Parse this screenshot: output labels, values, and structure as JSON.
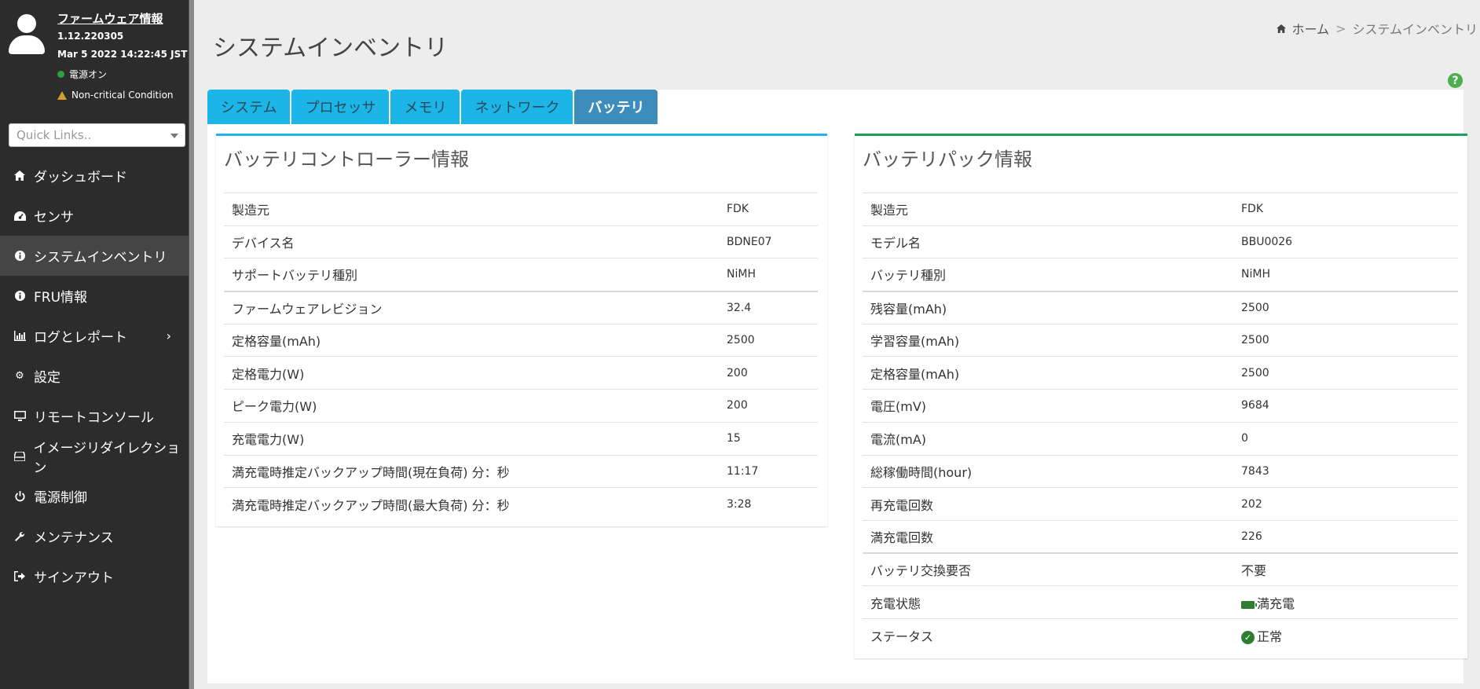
{
  "sidebar": {
    "fw_title": "ファームウェア情報",
    "fw_version": "1.12.220305",
    "fw_date": "Mar 5 2022 14:22:45 JST",
    "power_status": "電源オン",
    "health_status": "Non-critical Condition",
    "quicklinks_placeholder": "Quick Links..",
    "menu": [
      {
        "label": "ダッシュボード",
        "icon": "home-icon"
      },
      {
        "label": "センサ",
        "icon": "gauge-icon"
      },
      {
        "label": "システムインベントリ",
        "icon": "info-icon",
        "active": true
      },
      {
        "label": "FRU情報",
        "icon": "info-icon"
      },
      {
        "label": "ログとレポート",
        "icon": "bar-chart-icon"
      },
      {
        "label": "設定",
        "icon": "gear-icon"
      },
      {
        "label": "リモートコンソール",
        "icon": "monitor-icon"
      },
      {
        "label": "イメージリダイレクション",
        "icon": "drive-icon"
      },
      {
        "label": "電源制御",
        "icon": "power-icon"
      },
      {
        "label": "メンテナンス",
        "icon": "wrench-icon"
      },
      {
        "label": "サインアウト",
        "icon": "sign-out-icon"
      }
    ]
  },
  "header": {
    "title": "システムインベントリ",
    "breadcrumb_home": "ホーム",
    "breadcrumb_sep": ">",
    "breadcrumb_current": "システムインベントリ",
    "help_symbol": "?"
  },
  "tabs": [
    "システム",
    "プロセッサ",
    "メモリ",
    "ネットワーク",
    "バッテリ"
  ],
  "active_tab": "バッテリ",
  "controller": {
    "title": "バッテリコントローラー情報",
    "rows": [
      {
        "key": "製造元",
        "value": "FDK"
      },
      {
        "key": "デバイス名",
        "value": "BDNE07"
      },
      {
        "key": "サポートバッテリ種別",
        "value": "NiMH"
      },
      {
        "key": "ファームウェアレビジョン",
        "value": "32.4"
      },
      {
        "key": "定格容量(mAh)",
        "value": "2500"
      },
      {
        "key": "定格電力(W)",
        "value": "200"
      },
      {
        "key": "ピーク電力(W)",
        "value": "200"
      },
      {
        "key": "充電電力(W)",
        "value": "15"
      },
      {
        "key": "満充電時推定バックアップ時間(現在負荷) 分：秒",
        "value": "11:17"
      },
      {
        "key": "満充電時推定バックアップ時間(最大負荷) 分：秒",
        "value": "3:28"
      }
    ]
  },
  "pack": {
    "title": "バッテリパック情報",
    "rows": [
      {
        "key": "製造元",
        "value": "FDK"
      },
      {
        "key": "モデル名",
        "value": "BBU0026"
      },
      {
        "key": "バッテリ種別",
        "value": "NiMH"
      },
      {
        "key": "残容量(mAh)",
        "value": "2500"
      },
      {
        "key": "学習容量(mAh)",
        "value": "2500"
      },
      {
        "key": "定格容量(mAh)",
        "value": "2500"
      },
      {
        "key": "電圧(mV)",
        "value": "9684"
      },
      {
        "key": "電流(mA)",
        "value": "0"
      },
      {
        "key": "総稼働時間(hour)",
        "value": "7843"
      },
      {
        "key": "再充電回数",
        "value": "202"
      },
      {
        "key": "満充電回数",
        "value": "226"
      },
      {
        "key": "バッテリ交換要否",
        "value": "不要"
      },
      {
        "key": "充電状態",
        "value": "満充電",
        "icon": "battery-full-icon"
      },
      {
        "key": "ステータス",
        "value": "正常",
        "icon": "check-circle-icon"
      }
    ]
  },
  "colors": {
    "sidebar_bg": "#2c2c2c",
    "tab_bg": "#1bb5e8",
    "tab_active_bg": "#3c8dbc",
    "panel_left_accent": "#1bb5e8",
    "panel_right_accent": "#1ca05c",
    "status_ok": "#2e7d32"
  }
}
